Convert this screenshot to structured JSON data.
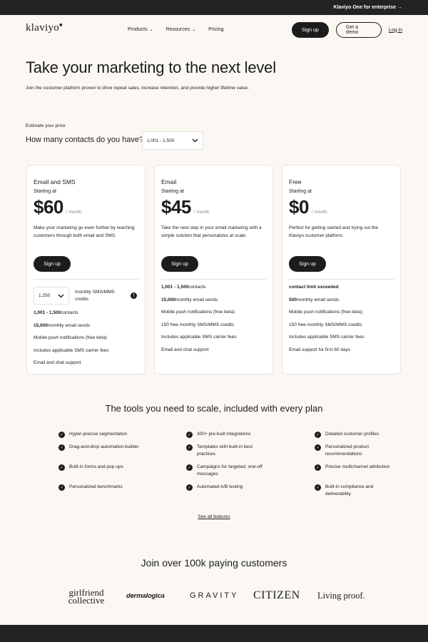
{
  "topbar": {
    "enterprise_link": "Klaviyo One for enterprise →"
  },
  "nav": {
    "logo": "klaviyo",
    "links": [
      {
        "label": "Products"
      },
      {
        "label": "Resources"
      },
      {
        "label": "Pricing"
      }
    ],
    "signup": "Sign up",
    "demo": "Get a demo",
    "login": "Log in"
  },
  "hero": {
    "title": "Take your marketing to the next level",
    "subtitle": "Join the customer platform proven to drive repeat sales, increase retention, and provide higher lifetime value."
  },
  "estimator": {
    "label": "Estimate your price",
    "question": "How many contacts do you have?",
    "selected": "1,001 - 1,500"
  },
  "plans": [
    {
      "name": "Email and SMS",
      "starting": "Starting at",
      "price": "$60",
      "per": "/ month",
      "description": "Make your marketing go even further by reaching customers through both email and SMS.",
      "cta": "Sign up",
      "sms_select": "1,250",
      "sms_label": "monthly SMS/MMS credits",
      "features": [
        {
          "bold": "1,001 - 1,500",
          "text": " contacts"
        },
        {
          "bold": "15,000",
          "text": " monthly email sends"
        },
        {
          "bold": "",
          "text": "Mobile push notifications (free beta)"
        },
        {
          "bold": "",
          "text": "Includes applicable SMS carrier fees"
        },
        {
          "bold": "",
          "text": "Email and chat support"
        }
      ]
    },
    {
      "name": "Email",
      "starting": "Starting at",
      "price": "$45",
      "per": "/ month",
      "description": "Take the next step in your email marketing with a simple solution that personalizes at scale.",
      "cta": "Sign up",
      "features": [
        {
          "bold": "1,001 - 1,500",
          "text": " contacts"
        },
        {
          "bold": "15,000",
          "text": " monthly email sends"
        },
        {
          "bold": "",
          "text": "Mobile push notifications (free beta)"
        },
        {
          "bold": "",
          "text": "150 free monthly SMS/MMS credits"
        },
        {
          "bold": "",
          "text": "Includes applicable SMS carrier fees"
        },
        {
          "bold": "",
          "text": "Email and chat support"
        }
      ]
    },
    {
      "name": "Free",
      "starting": "Starting at",
      "price": "$0",
      "per": "/ month",
      "description": "Perfect for getting started and trying out the Klaviyo customer platform.",
      "cta": "Sign up",
      "features": [
        {
          "bold": "contact limit exceeded",
          "text": ""
        },
        {
          "bold": "500",
          "text": " monthly email sends"
        },
        {
          "bold": "",
          "text": "Mobile push notifications (free beta)"
        },
        {
          "bold": "",
          "text": "150 free monthly SMS/MMS credits"
        },
        {
          "bold": "",
          "text": "Includes applicable SMS carrier fees"
        },
        {
          "bold": "",
          "text": "Email support for first 60 days"
        }
      ]
    }
  ],
  "tools": {
    "title": "The tools you need to scale, included with every plan",
    "columns": [
      [
        "Hyper-precise segmentation",
        "Drag-and-drop automation builder",
        "Built-in forms and pop-ups",
        "Personalized benchmarks"
      ],
      [
        "300+ pre-built integrations",
        "Templates with built-in best practices",
        "Campaigns for targeted, one-off messages",
        "Automated A/B testing"
      ],
      [
        "Detailed customer profiles",
        "Personalized product recommendations",
        "Precise multichannel attribution",
        "Built-in compliance and deliverability"
      ]
    ],
    "see_all": "See all features"
  },
  "customers": {
    "title": "Join over 100k paying customers",
    "logos": [
      "girlfriend collective",
      "dermalogica",
      "GRAVITY",
      "CITIZEN",
      "Living proof."
    ]
  }
}
